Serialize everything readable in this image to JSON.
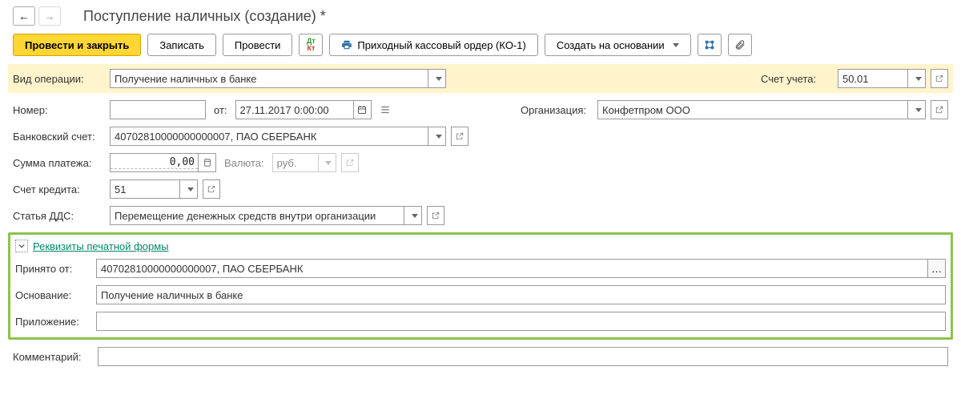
{
  "header": {
    "title": "Поступление наличных (создание) *"
  },
  "toolbar": {
    "submit_close": "Провести и закрыть",
    "save": "Записать",
    "submit": "Провести",
    "print_order": "Приходный кассовый ордер (КО-1)",
    "create_based": "Создать на основании"
  },
  "operation": {
    "label": "Вид операции:",
    "value": "Получение наличных в банке"
  },
  "account": {
    "label": "Счет учета:",
    "value": "50.01"
  },
  "number": {
    "label": "Номер:",
    "from_label": "от:",
    "date": "27.11.2017 0:00:00"
  },
  "organization": {
    "label": "Организация:",
    "value": "Конфетпром ООО"
  },
  "bank_account": {
    "label": "Банковский счет:",
    "value": "40702810000000000007, ПАО СБЕРБАНК"
  },
  "payment_sum": {
    "label": "Сумма платежа:",
    "value": "0,00",
    "currency_label": "Валюта:",
    "currency_value": "руб."
  },
  "credit_account": {
    "label": "Счет кредита:",
    "value": "51"
  },
  "dds": {
    "label": "Статья ДДС:",
    "value": "Перемещение денежных средств внутри организации"
  },
  "print_section": {
    "title": "Реквизиты печатной формы",
    "received_from": {
      "label": "Принято от:",
      "value": "40702810000000000007, ПАО СБЕРБАНК"
    },
    "basis": {
      "label": "Основание:",
      "value": "Получение наличных в банке"
    },
    "attachment": {
      "label": "Приложение:",
      "value": ""
    }
  },
  "comment": {
    "label": "Комментарий:",
    "value": ""
  }
}
